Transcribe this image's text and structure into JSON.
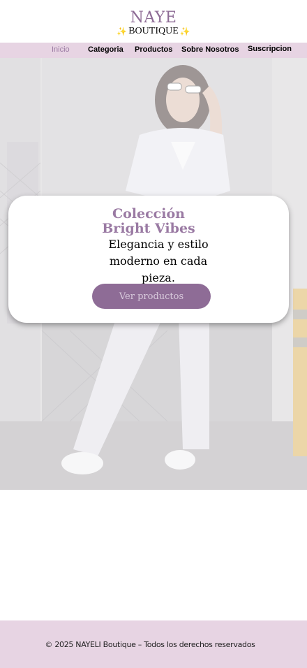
{
  "brand": {
    "name": "NAYE",
    "subtitle": "BOUTIQUE",
    "sparkle": "✨"
  },
  "nav": {
    "items": [
      {
        "label": "Inicio",
        "active": true
      },
      {
        "label": "Categoria"
      },
      {
        "label": "Productos"
      },
      {
        "label": "Sobre Nosotros"
      },
      {
        "label": "Suscripcion"
      }
    ]
  },
  "hero": {
    "title_line1": "Colección",
    "title_line2": "Bright Vibes",
    "tagline": "Elegancia y estilo moderno en cada pieza.",
    "cta_label": "Ver productos"
  },
  "footer": {
    "text": "© 2025 NAYELI Boutique – Todos los derechos reservados"
  },
  "colors": {
    "accent": "#8e6c96",
    "nav_bg": "#e7d4e3",
    "footer_bg": "#e7d4e3"
  }
}
